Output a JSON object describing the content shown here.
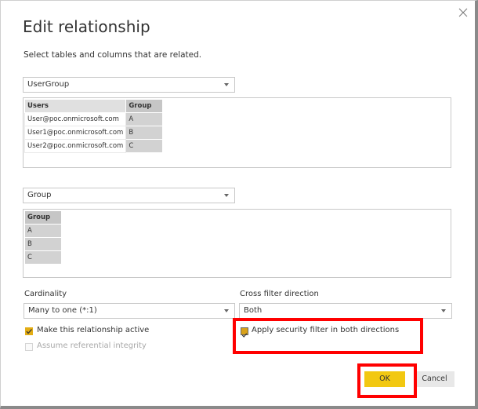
{
  "dialog": {
    "title": "Edit relationship",
    "subtitle": "Select tables and columns that are related."
  },
  "table1": {
    "selected": "UserGroup",
    "columns": [
      "Users",
      "Group"
    ],
    "selected_column": "Group",
    "rows": [
      [
        "User@poc.onmicrosoft.com",
        "A"
      ],
      [
        "User1@poc.onmicrosoft.com",
        "B"
      ],
      [
        "User2@poc.onmicrosoft.com",
        "C"
      ]
    ]
  },
  "table2": {
    "selected": "Group",
    "columns": [
      "Group"
    ],
    "selected_column": "Group",
    "rows": [
      [
        "A"
      ],
      [
        "B"
      ],
      [
        "C"
      ]
    ]
  },
  "cardinality": {
    "label": "Cardinality",
    "value": "Many to one (*:1)"
  },
  "cross_filter": {
    "label": "Cross filter direction",
    "value": "Both"
  },
  "options": {
    "make_active": "Make this relationship active",
    "make_active_checked": true,
    "referential_integrity": "Assume referential integrity",
    "referential_integrity_checked": false,
    "security_filter": "Apply security filter in both directions",
    "security_filter_checked": true
  },
  "buttons": {
    "ok": "OK",
    "cancel": "Cancel"
  },
  "colors": {
    "accent": "#f2c811",
    "highlight": "#ff0000"
  }
}
